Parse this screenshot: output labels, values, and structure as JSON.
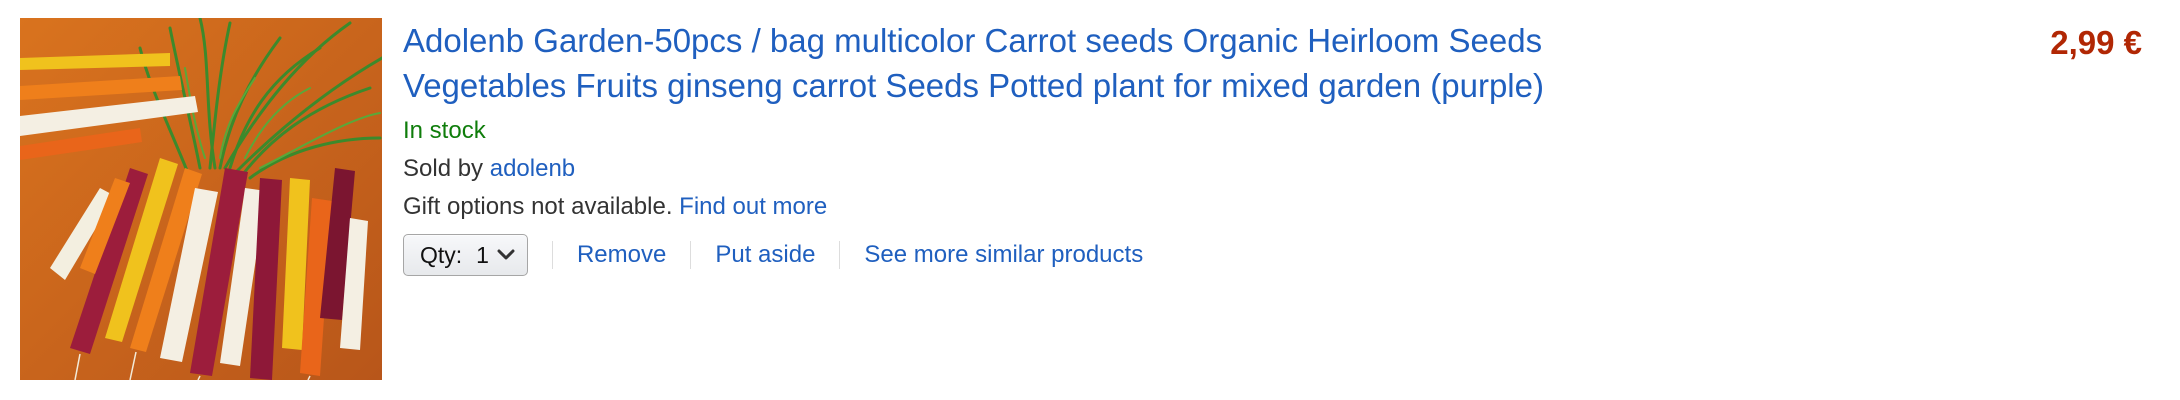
{
  "product": {
    "title": "Adolenb Garden-50pcs / bag multicolor Carrot seeds Organic Heirloom Seeds Vegetables Fruits ginseng carrot Seeds Potted plant for mixed garden (purple)",
    "image_icon": "multicolor-carrots-photo",
    "availability": "In stock",
    "sold_by_label": "Sold by",
    "seller": "adolenb",
    "gift_text": "Gift options not available.",
    "gift_link": "Find out more",
    "price": "2,99 €"
  },
  "actions": {
    "qty_label": "Qty:",
    "qty_value": "1",
    "remove": "Remove",
    "put_aside": "Put aside",
    "similar": "See more similar products"
  },
  "colors": {
    "link": "#1f5fbf",
    "in_stock": "#0f7d0b",
    "price": "#b12704",
    "image_background": "#c8651a"
  }
}
